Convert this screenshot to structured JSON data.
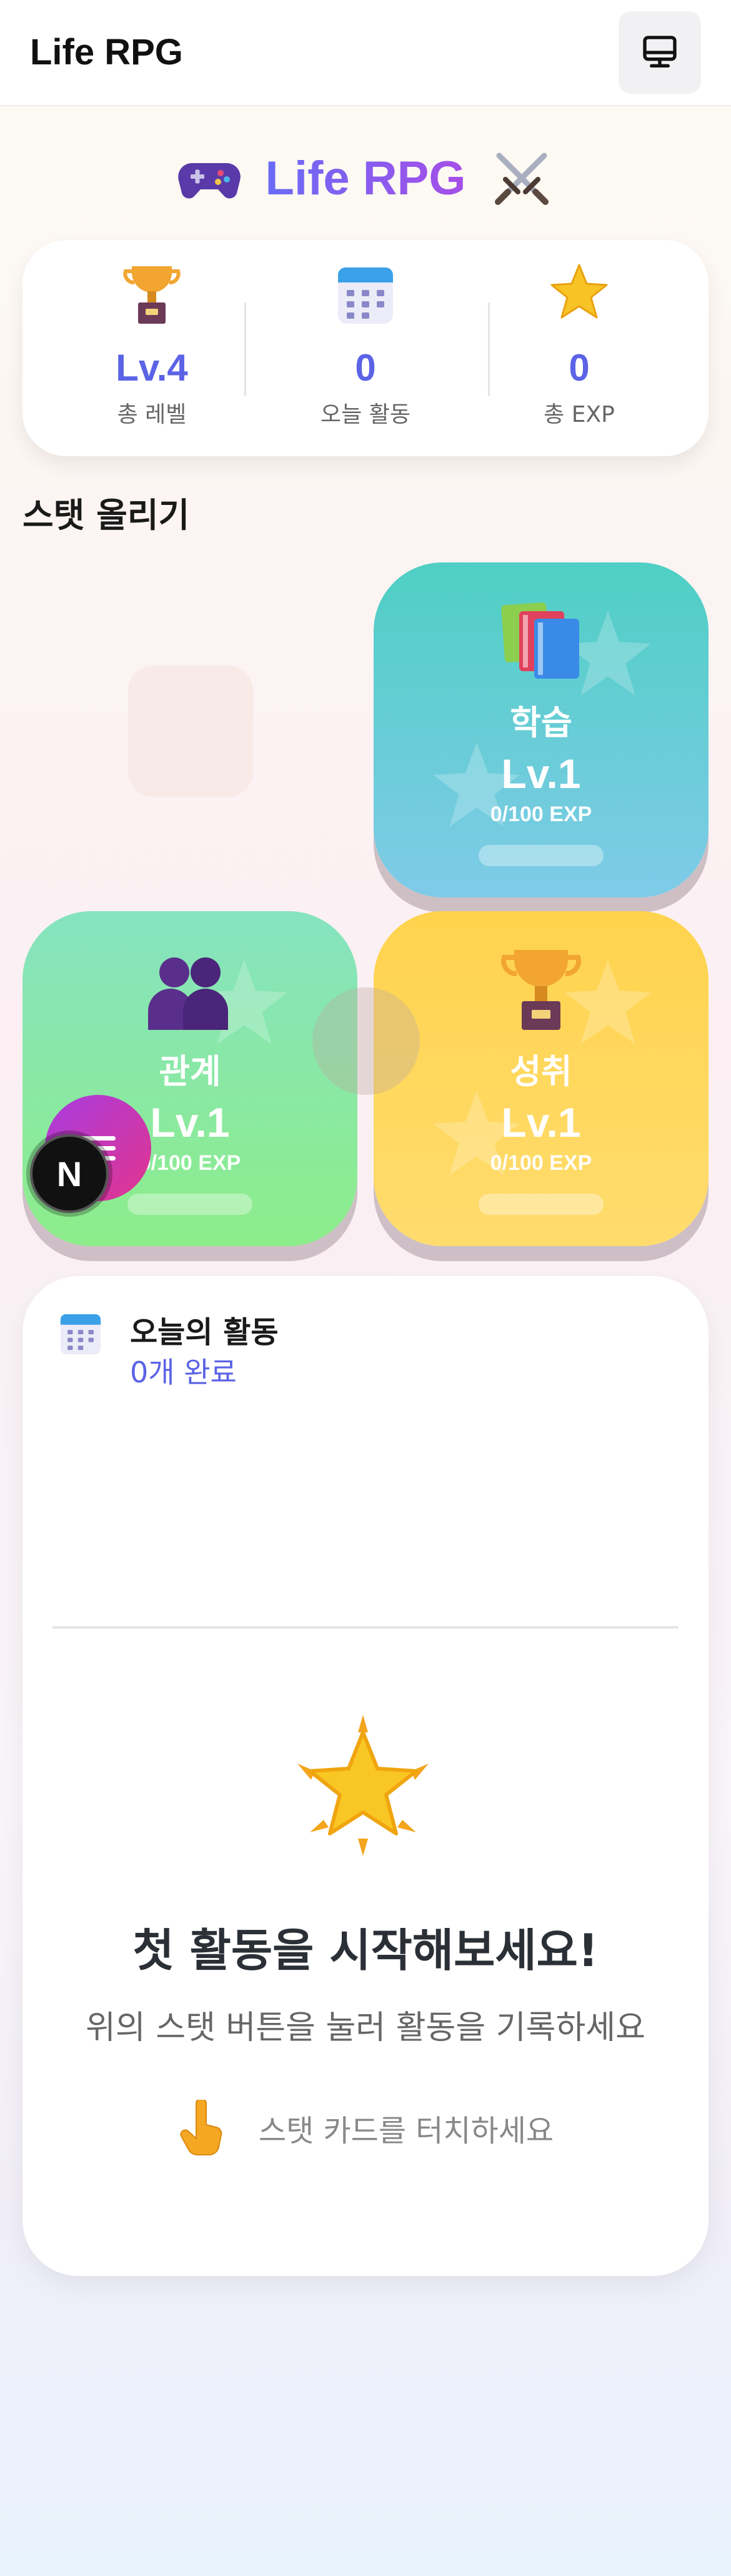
{
  "header": {
    "title": "Life RPG",
    "device_icon": "monitor-icon"
  },
  "hero": {
    "title": "Life RPG",
    "left_icon": "gamepad-icon",
    "right_icon": "crossed-swords-icon"
  },
  "summary": {
    "total_level": {
      "value": "Lv.4",
      "label": "총 레벨",
      "icon": "trophy-icon"
    },
    "today_activity": {
      "value": "0",
      "label": "오늘 활동",
      "icon": "calendar-icon"
    },
    "total_exp": {
      "value": "0",
      "label": "총 EXP",
      "icon": "star-icon"
    }
  },
  "stats": {
    "section_title": "스탯 올리기",
    "cards": [
      {
        "name": "학습",
        "level": "Lv.1",
        "exp": "0/100 EXP",
        "progress": 0,
        "icon": "books-icon",
        "color_top": "#4fcfc4",
        "color_bottom": "#7fcbe8"
      },
      {
        "name": "관계",
        "level": "Lv.1",
        "exp": "0/100 EXP",
        "progress": 0,
        "icon": "people-icon",
        "color_top": "#86e3c0",
        "color_bottom": "#8ded8a"
      },
      {
        "name": "성취",
        "level": "Lv.1",
        "exp": "0/100 EXP",
        "progress": 0,
        "icon": "trophy-icon",
        "color_top": "#ffd34d",
        "color_bottom": "#ffdc6e"
      }
    ]
  },
  "activity": {
    "title": "오늘의 활동",
    "count": "0개 완료",
    "empty_title": "첫 활동을 시작해보세요!",
    "empty_subtitle": "위의 스탯 버튼을 눌러 활동을 기록하세요",
    "hint": "스탯 카드를 터치하세요",
    "hint_icon": "pointing-hand-icon"
  },
  "fab": {
    "icon": "menu-icon"
  },
  "badge": {
    "letter": "N"
  },
  "colors": {
    "accent": "#5b63e6",
    "accent_purple": "#a64ee8"
  }
}
